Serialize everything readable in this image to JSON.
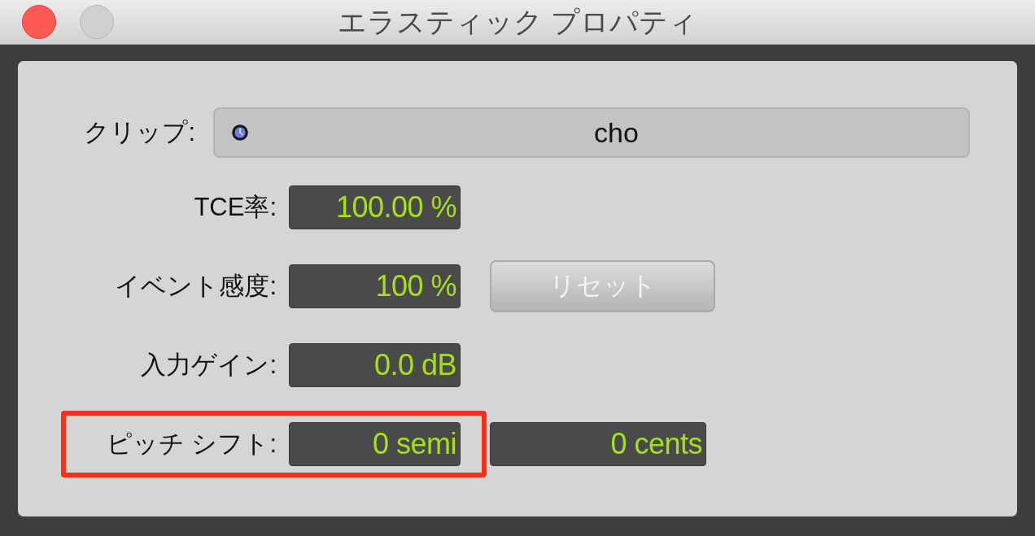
{
  "window": {
    "title": "エラスティック プロパティ"
  },
  "clip": {
    "label": "クリップ:",
    "value": "cho"
  },
  "fields": [
    {
      "label": "TCE率:",
      "values": [
        "100.00 %"
      ],
      "highlighted": false
    },
    {
      "label": "イベント感度:",
      "values": [
        "100 %"
      ],
      "highlighted": false,
      "button": {
        "label": "リセット",
        "disabled": true
      }
    },
    {
      "label": "入力ゲイン:",
      "values": [
        "0.0 dB"
      ],
      "highlighted": false
    },
    {
      "label": "ピッチ シフト:",
      "values": [
        "0 semi",
        "0 cents"
      ],
      "highlighted": true
    }
  ]
}
